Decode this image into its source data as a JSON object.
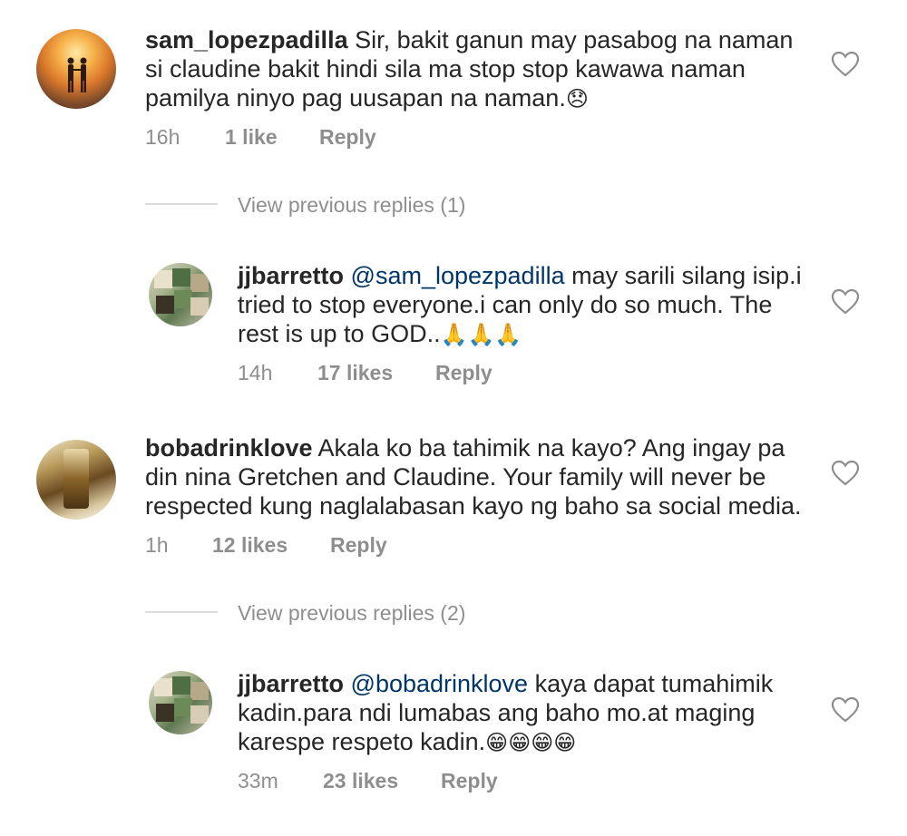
{
  "comments": [
    {
      "username": "sam_lopezpadilla",
      "line1": "Sir, bakit ganun may pasabog na naman",
      "line2": "si claudine bakit hindi sila ma stop stop kawawa naman",
      "line3": "pamilya ninyo pag uusapan na naman.",
      "emoji": "😞",
      "time": "16h",
      "likes": "1 like",
      "reply": "Reply",
      "avatar": "sunset-couple-avatar"
    },
    {
      "view_previous": "View previous replies (1)",
      "username": "jjbarretto",
      "mention": "@sam_lopezpadilla",
      "line1_rest": "may sarili silang isip.i",
      "line2": "tried to stop everyone.i can only do so much. The",
      "line3": "rest is up to GOD..",
      "emoji": "🙏🙏🙏",
      "time": "14h",
      "likes": "17 likes",
      "reply": "Reply"
    },
    {
      "username": "bobadrinklove",
      "line1": "Akala ko ba tahimik na kayo? Ang ingay pa",
      "line2": "din nina Gretchen and Claudine. Your family will never be",
      "line3": "respected kung naglalabasan kayo ng baho sa social media.",
      "time": "1h",
      "likes": "12 likes",
      "reply": "Reply"
    },
    {
      "view_previous": "View previous replies (2)",
      "username": "jjbarretto",
      "mention": "@bobadrinklove",
      "line1_rest": "kaya dapat tumahimik",
      "line2": "kadin.para ndi lumabas ang baho mo.at maging",
      "line3": "karespe respeto kadin.",
      "emoji": "😁😁😁😁",
      "time": "33m",
      "likes": "23 likes",
      "reply": "Reply"
    }
  ],
  "icons": {
    "like": "heart-outline-icon"
  },
  "colors": {
    "text": "#262626",
    "meta": "#8e8e8e",
    "mention": "#003569",
    "divider": "#dbdbdb"
  }
}
